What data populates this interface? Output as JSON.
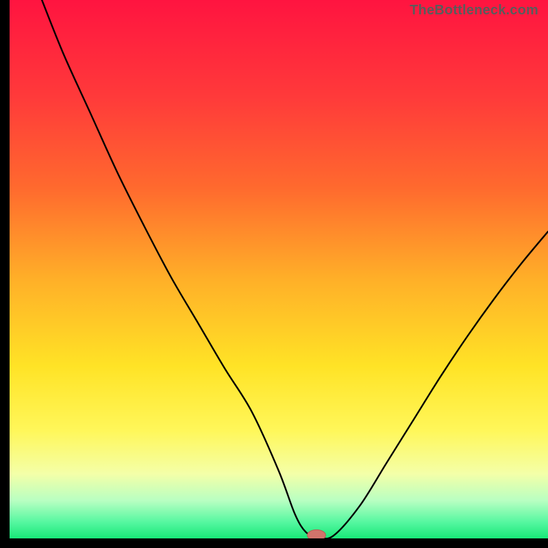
{
  "watermark": "TheBottleneck.com",
  "colors": {
    "black": "#000000",
    "curve": "#000000",
    "marker_fill": "#d1746b",
    "marker_stroke": "#b85a52"
  },
  "gradient_stops": [
    {
      "offset": 0.0,
      "color": "#ff1440"
    },
    {
      "offset": 0.18,
      "color": "#ff3a3a"
    },
    {
      "offset": 0.35,
      "color": "#ff6a2e"
    },
    {
      "offset": 0.52,
      "color": "#ffb028"
    },
    {
      "offset": 0.68,
      "color": "#ffe326"
    },
    {
      "offset": 0.8,
      "color": "#fff75a"
    },
    {
      "offset": 0.88,
      "color": "#f4ffa8"
    },
    {
      "offset": 0.93,
      "color": "#b8ffc2"
    },
    {
      "offset": 0.97,
      "color": "#55f7a0"
    },
    {
      "offset": 1.0,
      "color": "#18e878"
    }
  ],
  "chart_data": {
    "type": "line",
    "title": "",
    "xlabel": "",
    "ylabel": "",
    "xlim": [
      0,
      100
    ],
    "ylim": [
      0,
      100
    ],
    "grid": false,
    "legend": false,
    "series": [
      {
        "name": "bottleneck-curve",
        "x": [
          6,
          10,
          15,
          20,
          25,
          30,
          35,
          40,
          45,
          50,
          53,
          55,
          57,
          60,
          65,
          70,
          75,
          80,
          85,
          90,
          95,
          100
        ],
        "y": [
          100,
          90,
          79,
          68,
          58,
          48.5,
          40,
          31.5,
          23.5,
          12.5,
          4.5,
          1.2,
          0.4,
          0.4,
          6,
          14,
          22,
          30,
          37.5,
          44.5,
          51,
          57
        ]
      }
    ],
    "marker": {
      "name": "optimal-point",
      "x": 57,
      "y": 0.6,
      "rx": 1.7,
      "ry": 1.0
    }
  }
}
